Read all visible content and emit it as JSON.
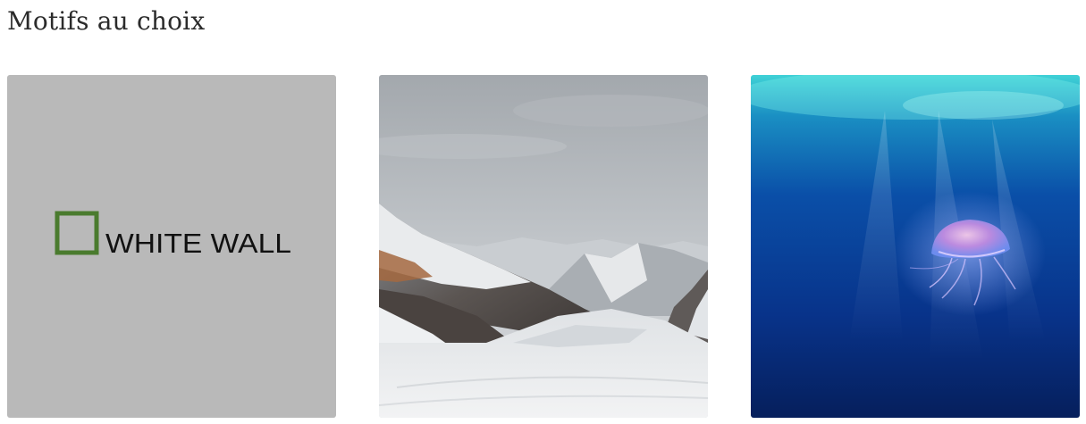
{
  "section": {
    "title": "Motifs au choix"
  },
  "tiles": [
    {
      "name": "WHITE WALL logo",
      "logo_text": "WHITE WALL",
      "background": "#b9b9b9",
      "frame_color": "#4a7b2e"
    },
    {
      "name": "Snowy mountain glacier valley"
    },
    {
      "name": "Jellyfish in deep blue ocean"
    }
  ],
  "icons": [
    "whitewall-logo-icon"
  ]
}
